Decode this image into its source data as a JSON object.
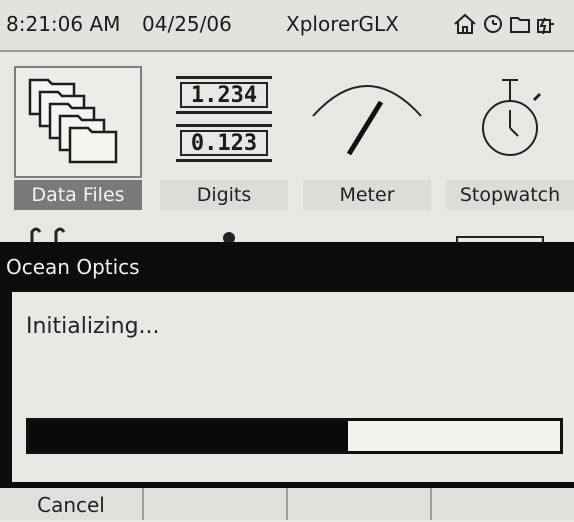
{
  "status_bar": {
    "time": "8:21:06 AM",
    "date": "04/25/06",
    "title": "XplorerGLX",
    "icons": [
      "home-icon",
      "clock-icon",
      "folder-icon",
      "battery-icon"
    ]
  },
  "apps": [
    {
      "label": "Data Files",
      "icon": "data-files-icon",
      "selected": true
    },
    {
      "label": "Digits",
      "icon": "digits-icon",
      "digits": [
        "1.234",
        "0.123"
      ]
    },
    {
      "label": "Meter",
      "icon": "meter-icon"
    },
    {
      "label": "Stopwatch",
      "icon": "stopwatch-icon"
    }
  ],
  "dialog": {
    "title": "Ocean Optics",
    "message": "Initializing...",
    "progress": 0.6
  },
  "softkeys": [
    "Cancel",
    "",
    "",
    ""
  ]
}
